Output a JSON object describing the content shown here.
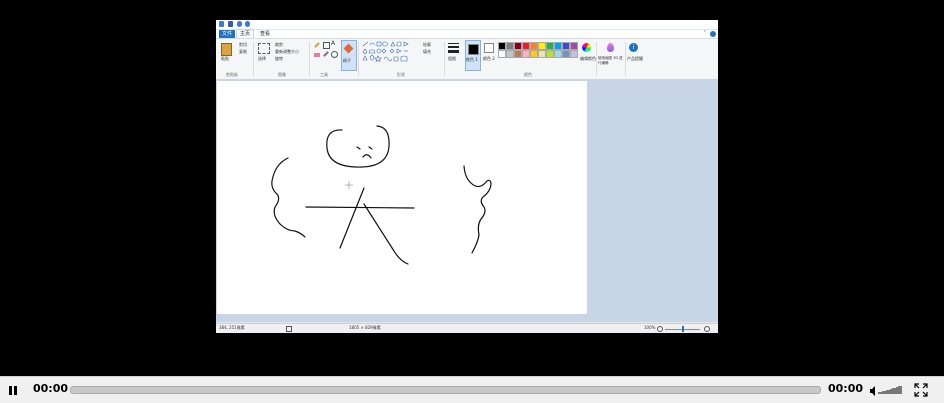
{
  "paint": {
    "tabs": {
      "file": "文件",
      "home": "主页",
      "view": "查看"
    },
    "groups": {
      "clipboard": "剪贴板",
      "image": "图像",
      "tools": "工具",
      "shapes": "形状",
      "colors": "颜色"
    },
    "ribbon": {
      "paste": "粘贴",
      "cut": "剪切",
      "copy": "复制",
      "select": "选择",
      "crop": "裁剪",
      "resize": "重新调整大小",
      "rotate": "旋转",
      "brush": "刷子",
      "outline": "轮廓",
      "fill": "填充",
      "size": "粗细",
      "color1": "颜色 1",
      "color2": "颜色 2",
      "edit_colors": "编辑颜色",
      "paint3d": "使用画图 3D 进行编辑",
      "alert": "产品提醒"
    },
    "status": {
      "cursor": "384, 251像素",
      "size": "1805 × 829像素",
      "zoom": "100%"
    },
    "palette": [
      "#000000",
      "#7f7f7f",
      "#880015",
      "#ed1c24",
      "#ff7f27",
      "#fff200",
      "#22b14c",
      "#00a2e8",
      "#3f48cc",
      "#a349a4",
      "#ffffff",
      "#c3c3c3",
      "#b97a57",
      "#ffaec9",
      "#ffc90e",
      "#efe4b0",
      "#b5e61d",
      "#99d9ea",
      "#7092be",
      "#c8bfe7"
    ]
  },
  "player": {
    "current_time": "00:00",
    "duration": "00:00",
    "progress": 0
  }
}
